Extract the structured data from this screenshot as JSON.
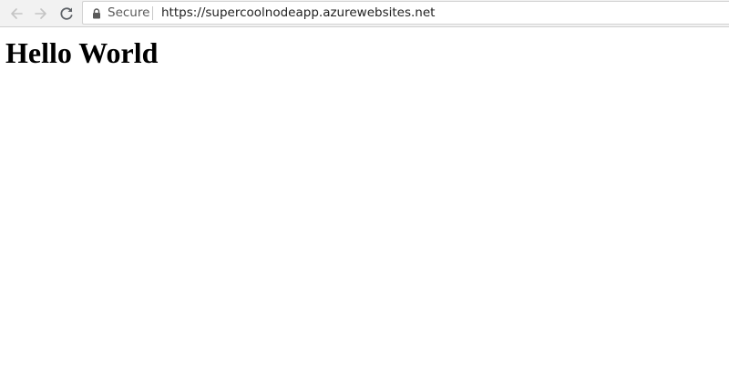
{
  "browser": {
    "nav": {
      "back_icon": "arrow-left-icon",
      "forward_icon": "arrow-right-icon",
      "reload_icon": "reload-icon"
    },
    "address_bar": {
      "lock_icon": "lock-icon",
      "secure_label": "Secure",
      "url": "https://supercoolnodeapp.azurewebsites.net"
    },
    "colors": {
      "toolbar_bg": "#f2f2f2",
      "icon_disabled": "#c4c4c4",
      "icon_active": "#5f6368",
      "secure_text": "#5a5a5a"
    }
  },
  "page": {
    "heading": "Hello World"
  }
}
